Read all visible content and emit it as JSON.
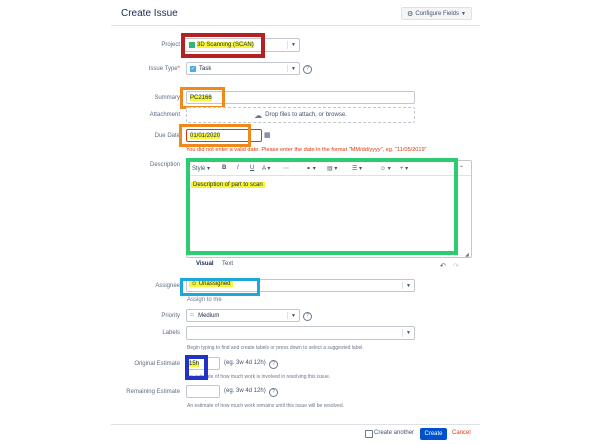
{
  "header": {
    "title": "Create Issue",
    "configure_label": "Configure Fields"
  },
  "project": {
    "label": "Project",
    "value": "3D Scanning (SCAN)"
  },
  "issue_type": {
    "label": "Issue Type",
    "required_mark": "*",
    "value": "Task"
  },
  "summary": {
    "label": "Summary",
    "value": "PC2166"
  },
  "attachment": {
    "label": "Attachment",
    "text_prefix": "Drop files to attach, or ",
    "browse_label": "browse."
  },
  "due_date": {
    "label": "Due Date",
    "value": "01/01/2020",
    "error": "You did not enter a valid date. Please enter the date in the format \"MM/dd/yyyy\", eg. \"11/05/2019\""
  },
  "description": {
    "label": "Description",
    "style_label": "Style",
    "value": "Description of part to scan",
    "tab_visual": "Visual",
    "tab_text": "Text"
  },
  "assignee": {
    "label": "Assignee",
    "value": "Unassigned",
    "assign_to_me": "Assign to me"
  },
  "priority": {
    "label": "Priority",
    "value": "Medium"
  },
  "labels": {
    "label": "Labels",
    "help": "Begin typing to find and create labels or press down to select a suggested label."
  },
  "original_estimate": {
    "label": "Original Estimate",
    "value": "15h",
    "example": "(eg. 3w 4d 12h)",
    "help": "An estimate of how much work is involved in resolving this issue."
  },
  "remaining_estimate": {
    "label": "Remaining Estimate",
    "value": "",
    "example": "(eg. 3w 4d 12h)",
    "help": "An estimate of how much work remains until this issue will be resolved."
  },
  "footer": {
    "create_another": "Create another",
    "create": "Create",
    "cancel": "Cancel"
  },
  "colors": {
    "red_box": "#b22222",
    "orange_box": "#f0891c",
    "green_box": "#2ecc71",
    "cyan_box": "#1fa7d9",
    "blue_box": "#2233c4",
    "highlight": "#f7f43a",
    "primary": "#0052cc"
  }
}
